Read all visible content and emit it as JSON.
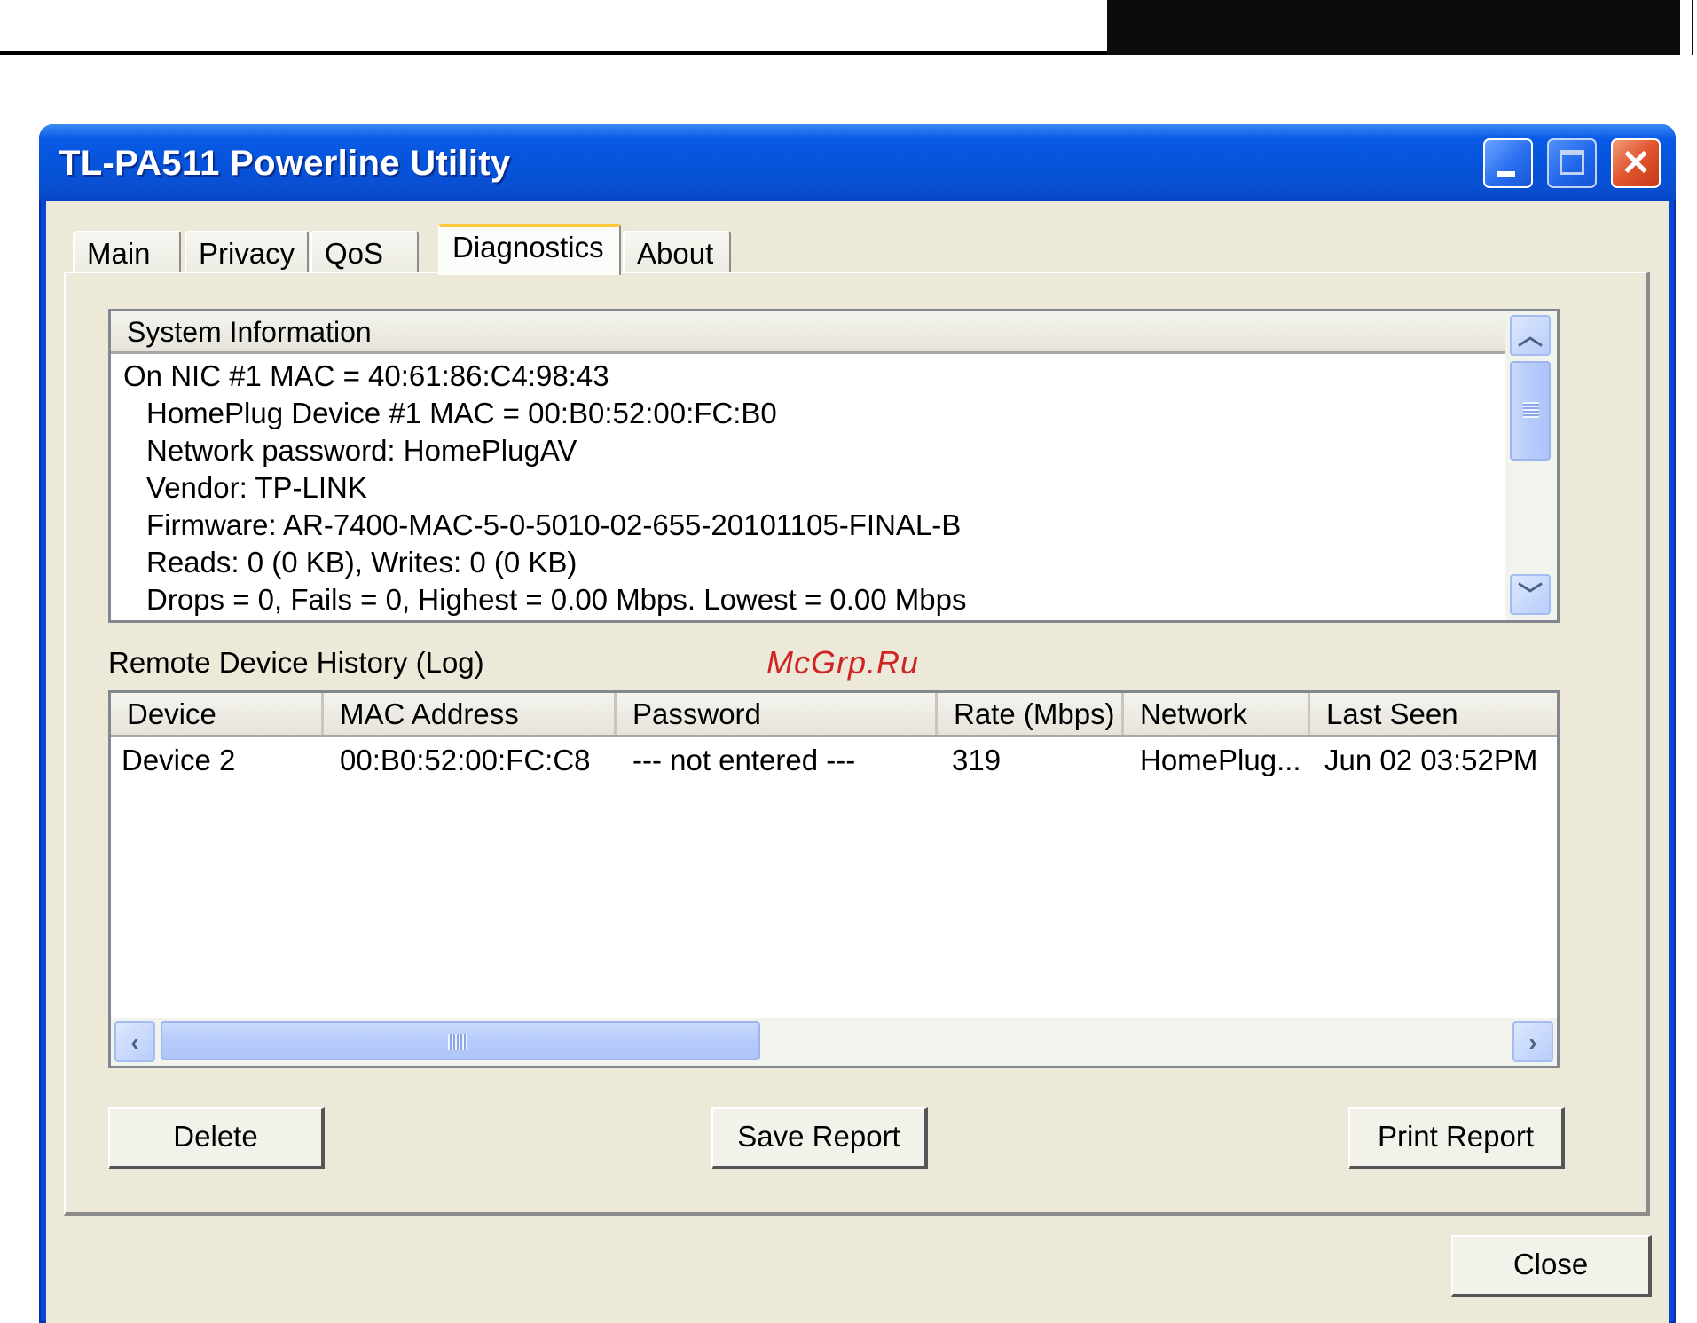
{
  "window": {
    "title": "TL-PA511 Powerline Utility",
    "controls": {
      "minimize": "minimize-icon",
      "maximize": "maximize-icon",
      "close": "close-icon",
      "close_glyph": "✕"
    }
  },
  "tabs": [
    {
      "label": "Main",
      "active": false
    },
    {
      "label": "Privacy",
      "active": false
    },
    {
      "label": "QoS",
      "active": false
    },
    {
      "label": "Diagnostics",
      "active": true
    },
    {
      "label": "About",
      "active": false
    }
  ],
  "system_info": {
    "header": "System Information",
    "lines": [
      "On NIC #1 MAC = 40:61:86:C4:98:43",
      "HomePlug Device #1 MAC = 00:B0:52:00:FC:B0",
      "Network password: HomePlugAV",
      "Vendor: TP-LINK",
      "Firmware: AR-7400-MAC-5-0-5010-02-655-20101105-FINAL-B",
      "Reads: 0 (0 KB), Writes: 0 (0 KB)",
      "Drops = 0, Fails = 0, Highest = 0.00 Mbps. Lowest = 0.00 Mbps"
    ],
    "scroll_up_glyph": "︿",
    "scroll_down_glyph": "﹀"
  },
  "log": {
    "label": "Remote Device History (Log)",
    "columns": [
      "Device",
      "MAC Address",
      "Password",
      "Rate (Mbps)",
      "Network",
      "Last Seen"
    ],
    "rows": [
      [
        "Device 2",
        "00:B0:52:00:FC:C8",
        "--- not entered ---",
        "319",
        "HomePlug...",
        "Jun 02 03:52PM"
      ]
    ],
    "scroll_left_glyph": "‹",
    "scroll_right_glyph": "›"
  },
  "buttons": {
    "delete": "Delete",
    "save_report": "Save Report",
    "print_report": "Print Report",
    "close": "Close"
  },
  "watermark": "McGrp.Ru"
}
